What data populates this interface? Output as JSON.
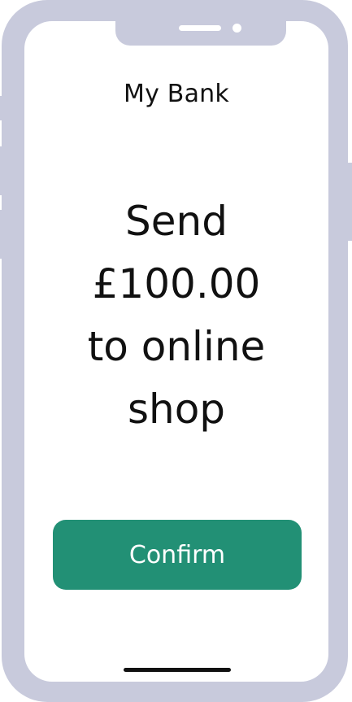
{
  "app": {
    "title": "My Bank"
  },
  "payment": {
    "line1": "Send",
    "line2": "£100.00",
    "line3": "to online",
    "line4": "shop"
  },
  "actions": {
    "confirm_label": "Confirm"
  },
  "colors": {
    "frame": "#c8cadc",
    "accent": "#229075",
    "text": "#111111",
    "screen": "#ffffff"
  }
}
